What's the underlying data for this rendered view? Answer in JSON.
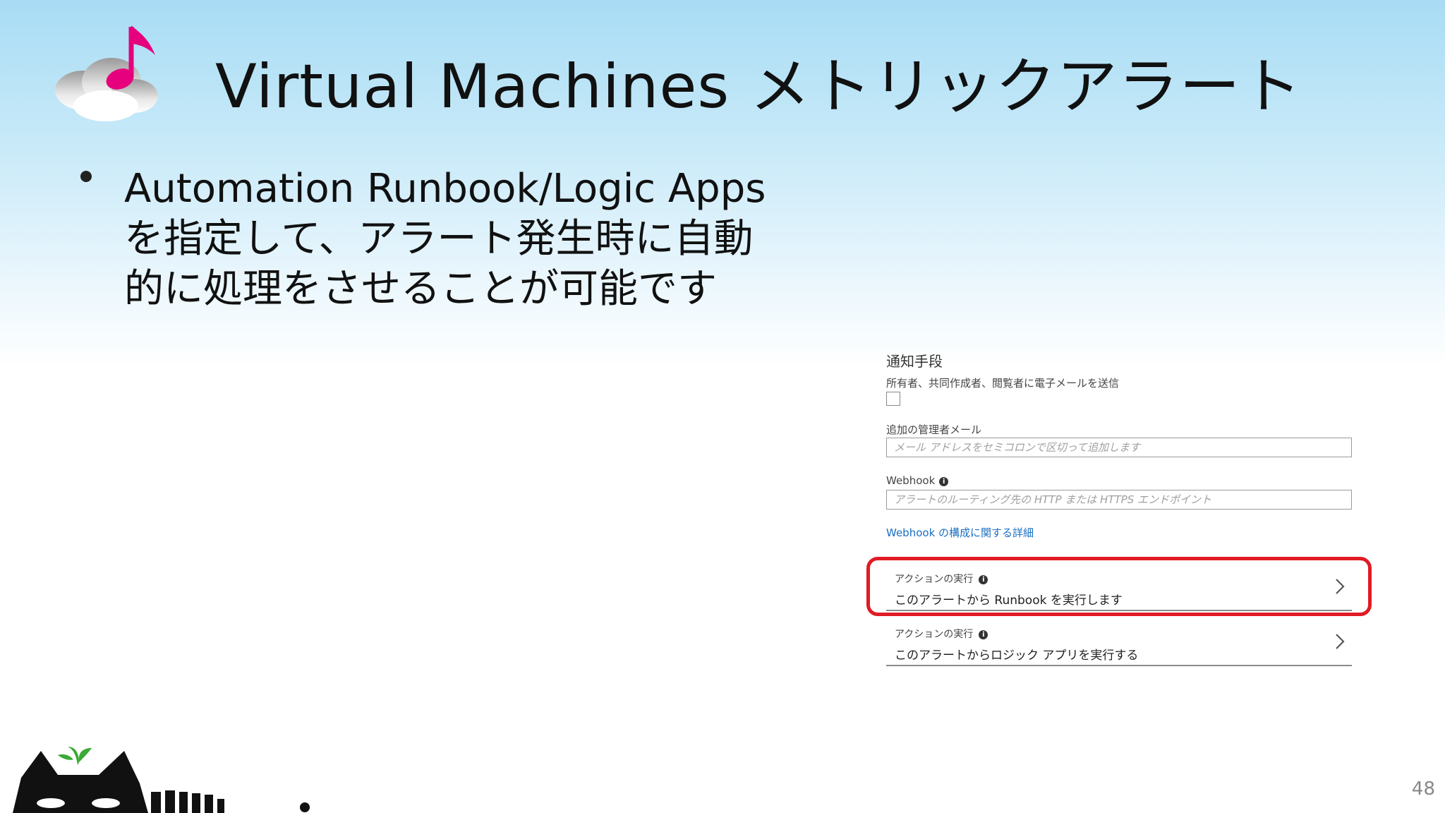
{
  "slide": {
    "title": "Virtual Machines メトリックアラート",
    "bullet_lines": [
      "Automation Runbook/Logic Apps",
      "を指定して、アラート発生時に自動",
      "的に処理をさせることが可能です"
    ],
    "page_number": "48"
  },
  "panel": {
    "heading": "通知手段",
    "owner_email_label": "所有者、共同作成者、閲覧者に電子メールを送信",
    "owner_email_checked": false,
    "admin_email": {
      "label": "追加の管理者メール",
      "value": "",
      "placeholder": "メール アドレスをセミコロンで区切って追加します"
    },
    "webhook": {
      "label": "Webhook",
      "value": "",
      "placeholder": "アラートのルーティング先の HTTP または HTTPS エンドポイント"
    },
    "webhook_link": "Webhook の構成に関する詳細",
    "actions": [
      {
        "label": "アクションの実行",
        "description": "このアラートから Runbook を実行します",
        "highlighted": true
      },
      {
        "label": "アクションの実行",
        "description": "このアラートからロジック アプリを実行する",
        "highlighted": false
      }
    ]
  },
  "colors": {
    "highlight": "#e01b24",
    "link": "#1a6fc4",
    "note": "#e6007e"
  },
  "icons": {
    "logo": "music-note-cloud-icon",
    "info": "info-icon",
    "chevron": "chevron-right-icon",
    "mascot": "black-cat-sprout-icon"
  }
}
